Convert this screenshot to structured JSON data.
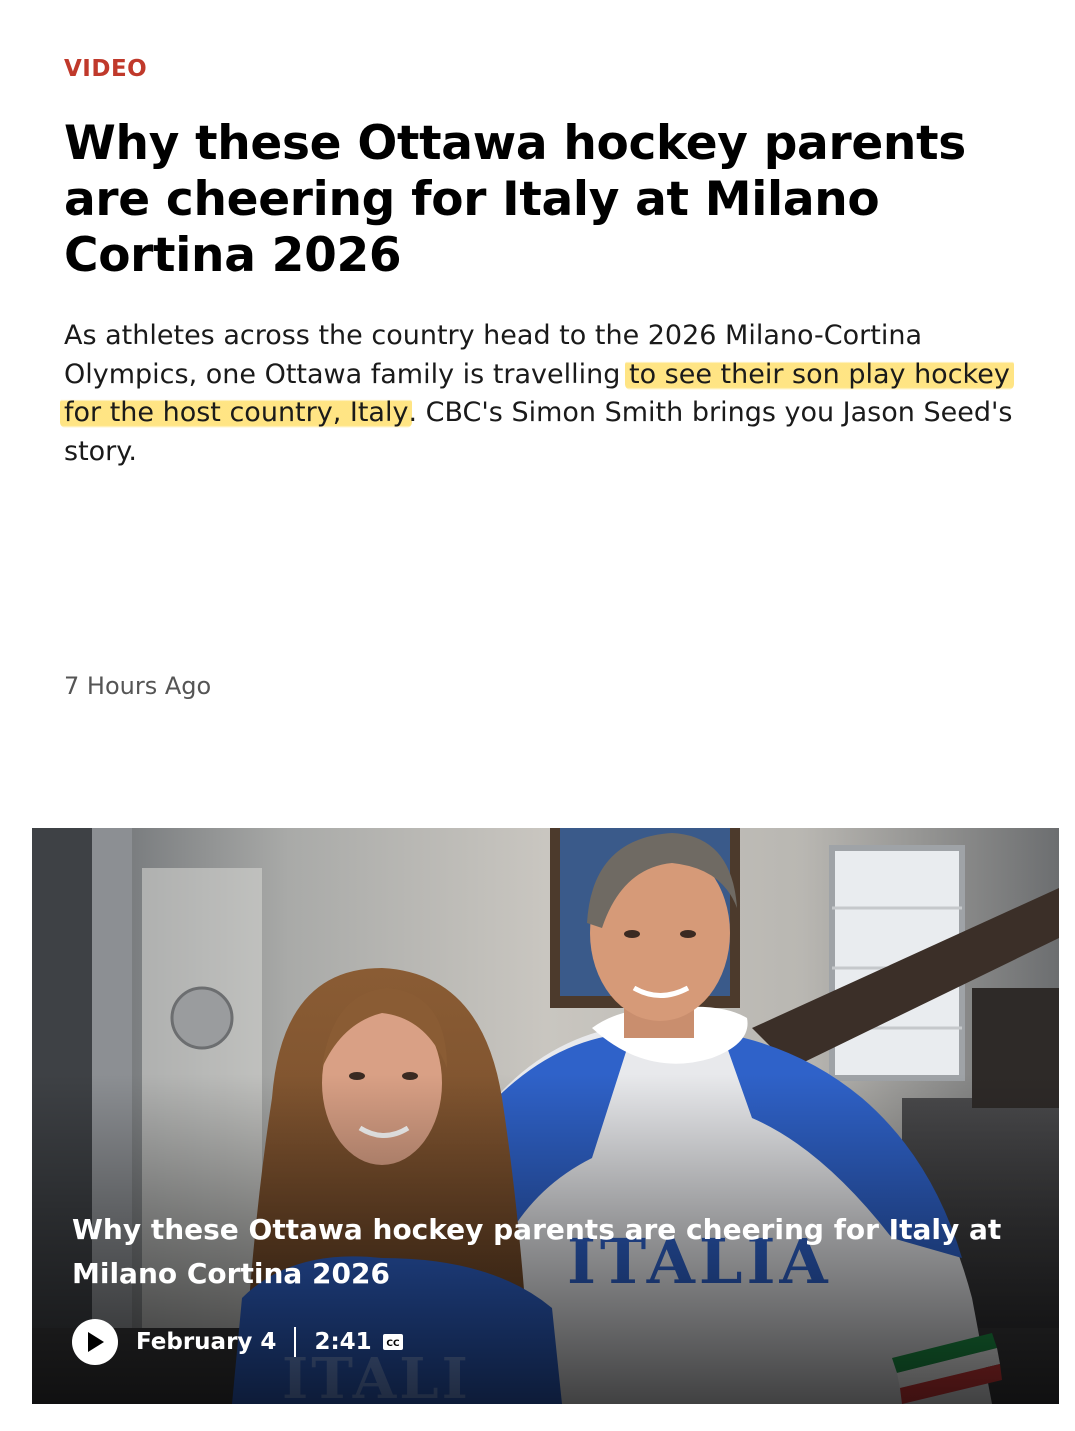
{
  "article": {
    "category": "VIDEO",
    "headline": "Why these Ottawa hockey parents are cheering for Italy at Milano Cortina 2026",
    "deck": {
      "before": "As athletes across the country head to the 2026 Milano-Cortina Olympics, one Ottawa family is travelling ",
      "highlighted": "to see their son play hockey for the host country, Italy",
      "after": ". CBC's Simon Smith brings you Jason Seed's story."
    },
    "timestamp": "7 Hours Ago"
  },
  "video": {
    "title": "Why these Ottawa hockey parents are cheering for Italy at Milano Cortina 2026",
    "date": "February 4",
    "duration": "2:41",
    "cc_label": "CC",
    "jersey_text": "ITALIA"
  },
  "colors": {
    "category": "#c0392b",
    "highlight": "#ffe06e",
    "jersey_blue": "#2f62c9"
  },
  "icons": {
    "play": "play-icon",
    "cc": "closed-captions-icon"
  }
}
